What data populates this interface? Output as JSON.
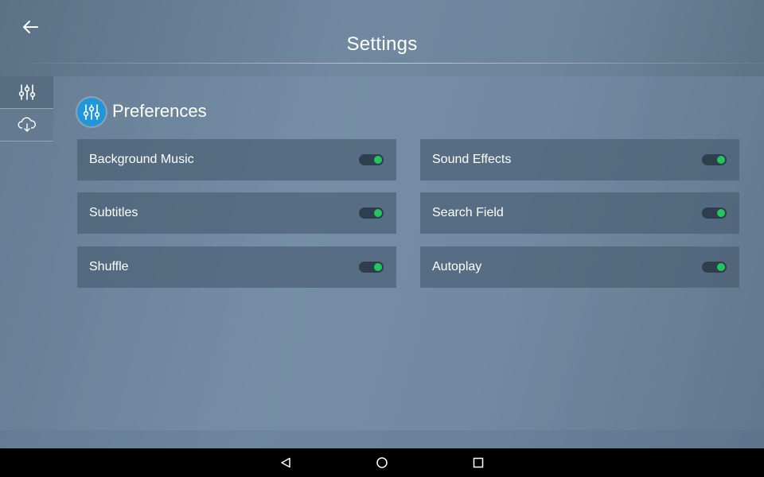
{
  "header": {
    "title": "Settings",
    "back_icon": "arrow-left-icon"
  },
  "sidebar": {
    "items": [
      {
        "icon": "sliders-icon",
        "active": true
      },
      {
        "icon": "cloud-download-icon",
        "active": false
      }
    ]
  },
  "section": {
    "title": "Preferences",
    "icon": "sliders-icon",
    "icon_color": "#2196d9"
  },
  "settings": [
    {
      "label": "Background Music",
      "on": true
    },
    {
      "label": "Sound Effects",
      "on": true
    },
    {
      "label": "Subtitles",
      "on": true
    },
    {
      "label": "Search Field",
      "on": true
    },
    {
      "label": "Shuffle",
      "on": true
    },
    {
      "label": "Autoplay",
      "on": true
    }
  ],
  "colors": {
    "toggle_on": "#22c55e",
    "accent": "#2196d9"
  },
  "navbar": {
    "buttons": [
      "back-triangle-icon",
      "home-circle-icon",
      "recents-square-icon"
    ]
  }
}
